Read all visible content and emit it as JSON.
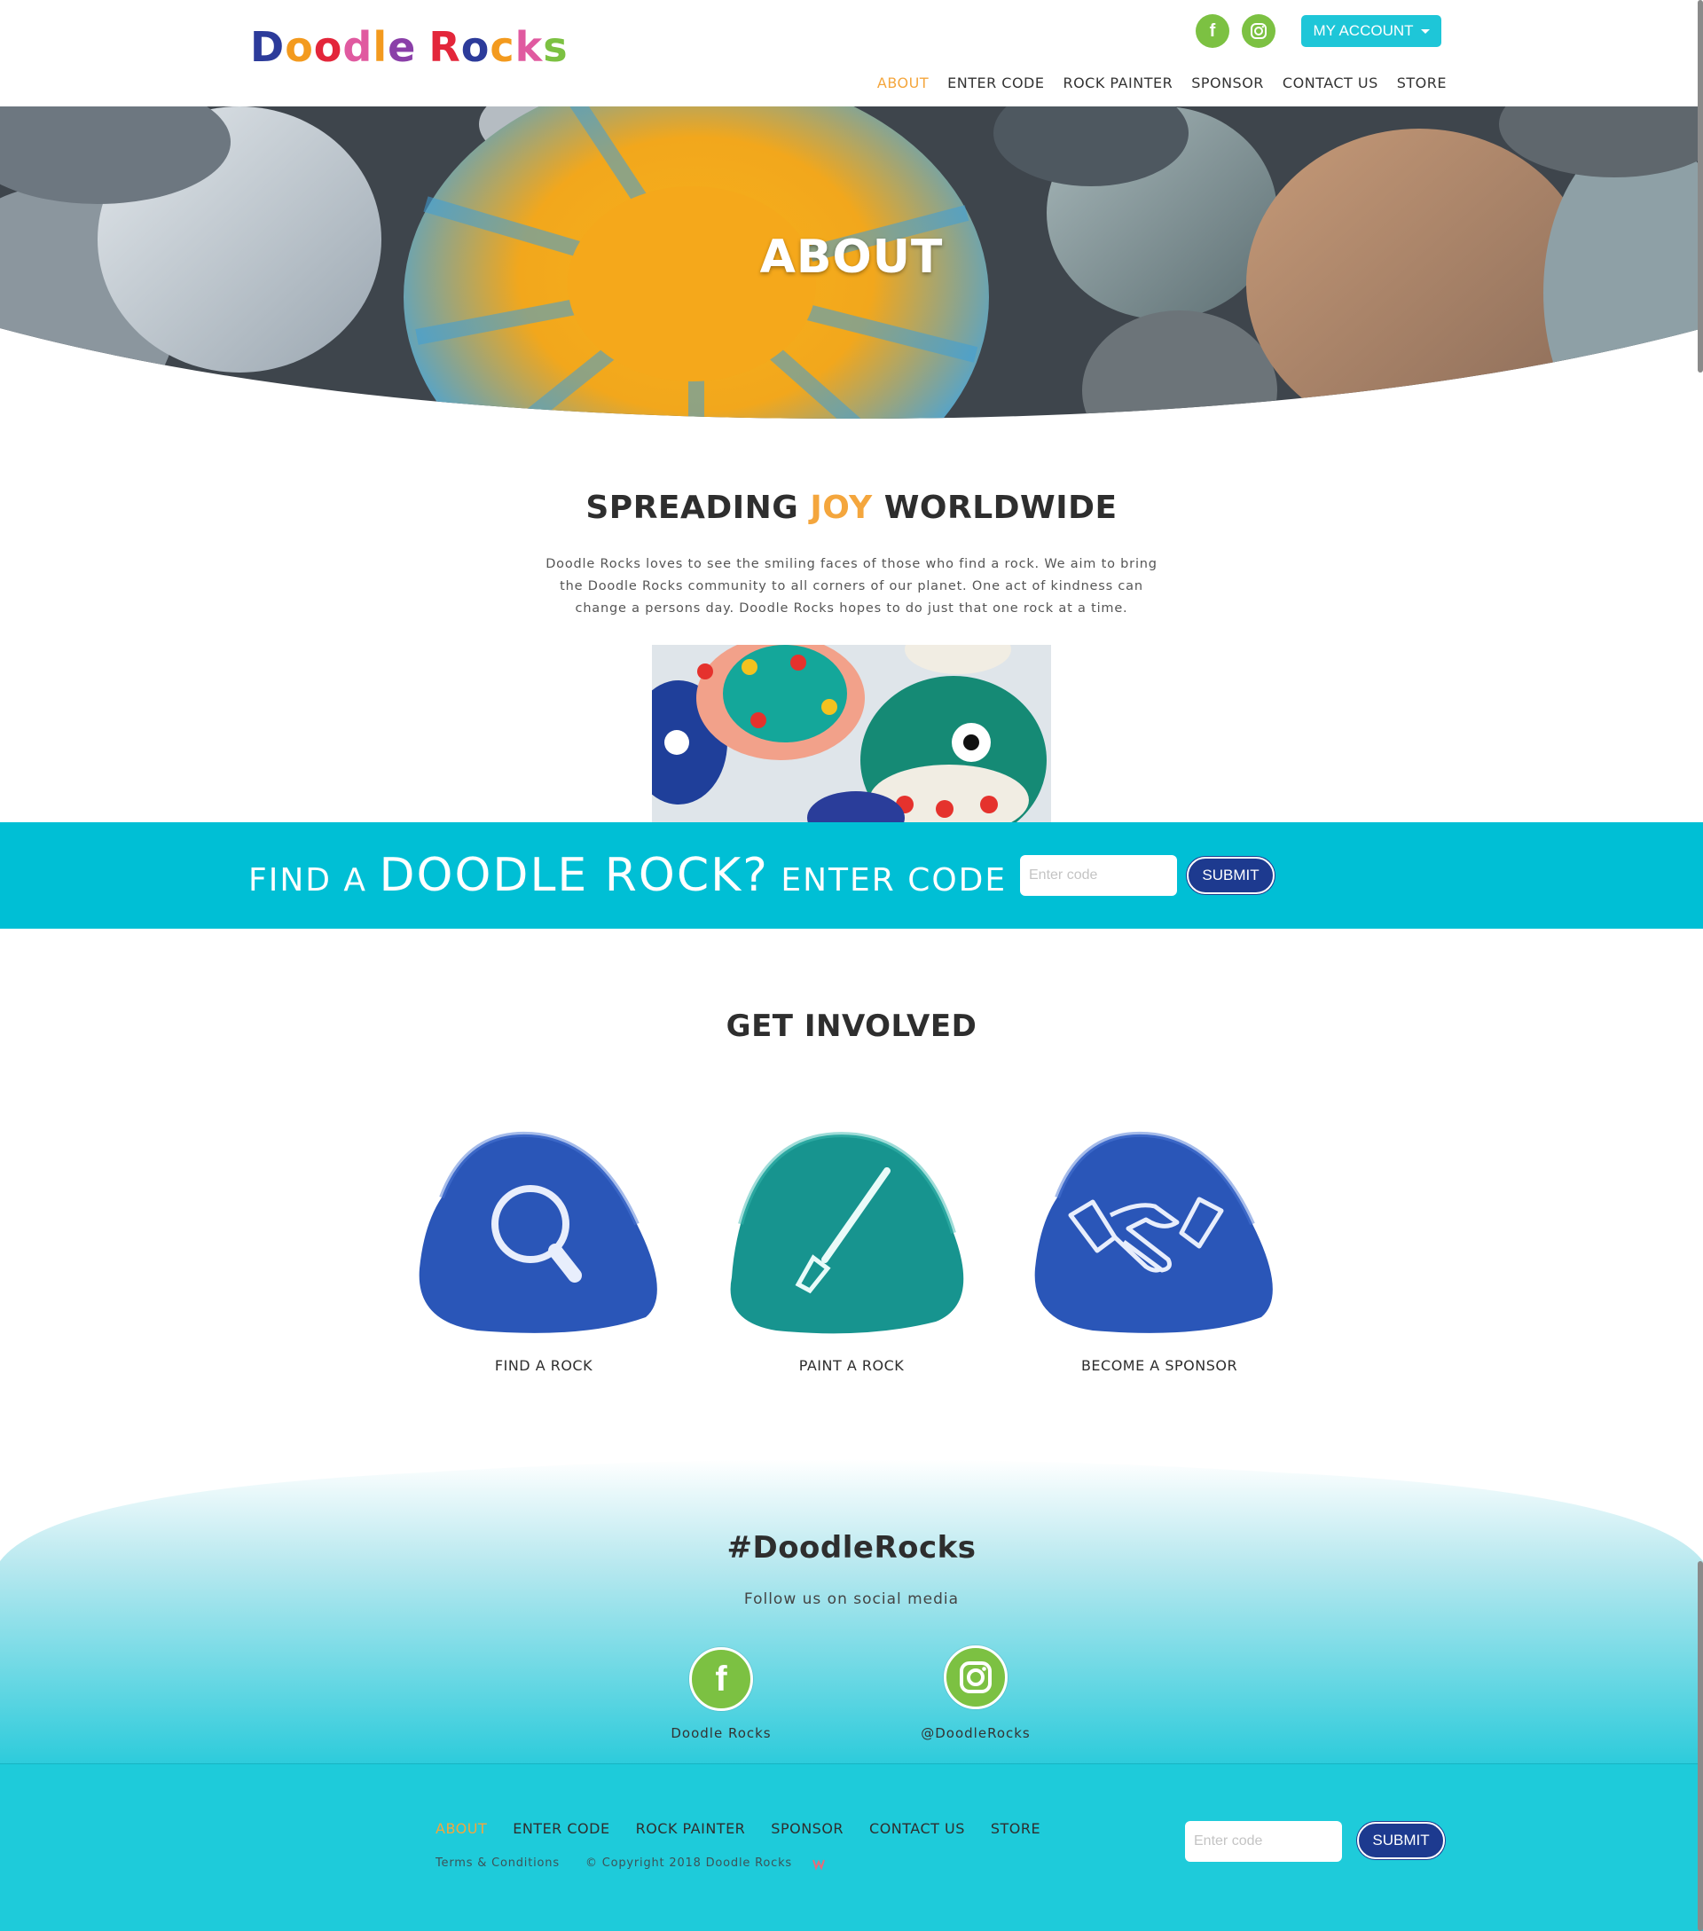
{
  "header": {
    "logo_letters": [
      "D",
      "o",
      "o",
      "d",
      "l",
      "e",
      " ",
      "R",
      "o",
      "c",
      "k",
      "s"
    ],
    "social": [
      {
        "icon": "facebook-icon",
        "glyph": "f"
      },
      {
        "icon": "instagram-icon",
        "glyph": "◎"
      }
    ],
    "account_label": "MY ACCOUNT",
    "nav": [
      "ABOUT",
      "ENTER CODE",
      "ROCK PAINTER",
      "SPONSOR",
      "CONTACT US",
      "STORE"
    ],
    "active_nav": "ABOUT"
  },
  "hero": {
    "title": "ABOUT"
  },
  "intro": {
    "heading_pre": "SPREADING ",
    "heading_highlight": "JOY",
    "heading_post": " WORLDWIDE",
    "text": "Doodle Rocks loves to see the smiling faces of those who find a rock. We aim to bring the Doodle Rocks community to all corners of our planet. One act of kindness can change a persons day. Doodle Rocks hopes to do just that one rock at a time."
  },
  "code_band": {
    "text_1": "FIND A ",
    "text_2": "DOODLE ROCK?",
    "text_3": " ENTER CODE",
    "input_placeholder": "Enter code",
    "submit_label": "SUBMIT"
  },
  "involved": {
    "heading": "GET INVOLVED",
    "cards": [
      {
        "label": "FIND A ROCK",
        "icon": "magnifier-icon",
        "color": "#2a56b8"
      },
      {
        "label": "PAINT A ROCK",
        "icon": "paintbrush-icon",
        "color": "#17948f"
      },
      {
        "label": "BECOME A SPONSOR",
        "icon": "handshake-icon",
        "color": "#2a56b8"
      }
    ]
  },
  "social_section": {
    "hashtag": "#DoodleRocks",
    "subtitle": "Follow us on social media",
    "facebook_label": "Doodle Rocks",
    "instagram_label": "@DoodleRocks"
  },
  "footer": {
    "nav": [
      "ABOUT",
      "ENTER CODE",
      "ROCK PAINTER",
      "SPONSOR",
      "CONTACT US",
      "STORE"
    ],
    "active_nav": "ABOUT",
    "terms": "Terms & Conditions",
    "copyright": "© Copyright 2018 Doodle Rocks",
    "input_placeholder": "Enter code",
    "submit_label": "SUBMIT"
  },
  "colors": {
    "accent": "#00bfd5",
    "orange": "#f4a63d",
    "green": "#7cc142",
    "navy": "#1d3a8f"
  }
}
